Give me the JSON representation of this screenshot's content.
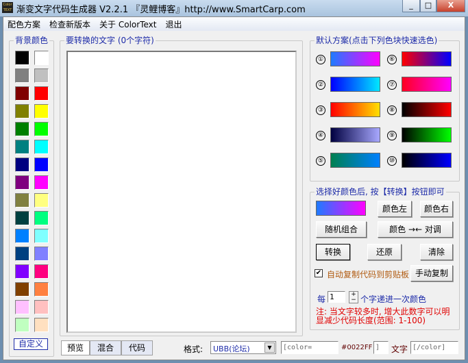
{
  "window": {
    "title": "渐变文字代码生成器 V2.2.1 『灵鲤博客』http://www.SmartCarp.com",
    "minimize": "_",
    "maximize": "□",
    "close": "X"
  },
  "menu": [
    "配色方案",
    "检查新版本",
    "关于 ColorText",
    "退出"
  ],
  "bg_colors": {
    "label": "背景颜色",
    "custom_label": "自定义",
    "swatches": [
      [
        "#000000",
        "#ffffff"
      ],
      [
        "#808080",
        "#c0c0c0"
      ],
      [
        "#800000",
        "#ff0000"
      ],
      [
        "#808000",
        "#ffff00"
      ],
      [
        "#008000",
        "#00ff00"
      ],
      [
        "#008080",
        "#00ffff"
      ],
      [
        "#000080",
        "#0000ff"
      ],
      [
        "#800080",
        "#ff00ff"
      ],
      [
        "#808040",
        "#ffff80"
      ],
      [
        "#004040",
        "#00ff80"
      ],
      [
        "#0080ff",
        "#80ffff"
      ],
      [
        "#004080",
        "#8080ff"
      ],
      [
        "#8000ff",
        "#ff0080"
      ],
      [
        "#804000",
        "#ff8040"
      ],
      [
        "#ffc0ff",
        "#ffc0c0"
      ],
      [
        "#c0ffc0",
        "#ffe0c0"
      ]
    ]
  },
  "text_area": {
    "label": "要转换的文字 (0个字符)",
    "value": ""
  },
  "presets": {
    "label": "默认方案(点击下列色块快速选色)",
    "items": [
      {
        "n": "①",
        "from": "#1e7bff",
        "to": "#ff00ff"
      },
      {
        "n": "②",
        "from": "#0000ff",
        "to": "#00e8ff"
      },
      {
        "n": "③",
        "from": "#ff0000",
        "to": "#ffe000"
      },
      {
        "n": "④",
        "from": "#000040",
        "to": "#a8a8ff"
      },
      {
        "n": "⑤",
        "from": "#008050",
        "to": "#0080ff"
      },
      {
        "n": "⑥",
        "from": "#ff0000",
        "to": "#0000ff"
      },
      {
        "n": "⑦",
        "from": "#ff0020",
        "to": "#ff00ff"
      },
      {
        "n": "⑧",
        "from": "#000000",
        "to": "#ff0000"
      },
      {
        "n": "⑨",
        "from": "#000000",
        "to": "#00ff00"
      },
      {
        "n": "⑩",
        "from": "#000000",
        "to": "#0000ff"
      }
    ]
  },
  "controls": {
    "label": "选择好颜色后, 按【转换】按钮即可",
    "current_from": "#1e7bff",
    "current_to": "#ff00ff",
    "left_color": "颜色左",
    "right_color": "颜色右",
    "random": "随机组合",
    "swap": "颜色 →← 对调",
    "convert": "转换",
    "restore": "还原",
    "clear": "清除",
    "auto_copy": "自动复制代码到剪贴板",
    "auto_copy_checked": true,
    "manual_copy": "手动复制",
    "step_prefix": "每",
    "step_value": "1",
    "step_suffix": "个字递进一次颜色",
    "note": "注: 当文字较多时, 增大此数字可以明显减少代码长度(范围: 1-100)"
  },
  "bottom": {
    "tabs": [
      "预览",
      "混合",
      "代码"
    ],
    "format_label": "格式:",
    "format_value": "UBB(论坛)",
    "open_tag": "[color=",
    "color_value": "#0022FF",
    "close_bracket": "]",
    "text_label": "文字",
    "end_tag": "[/color]"
  }
}
